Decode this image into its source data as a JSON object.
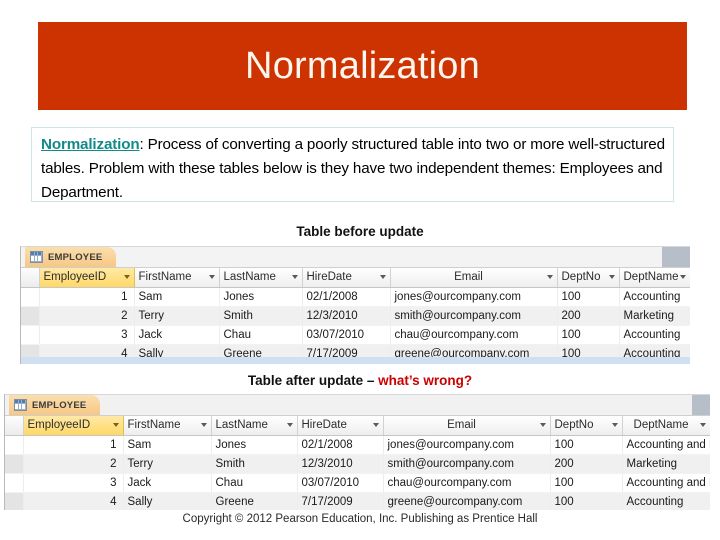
{
  "slide": {
    "title": "Normalization",
    "banner_color": "#cc3300"
  },
  "definition": {
    "term": "Normalization",
    "term_color": "#128a8a",
    "body": ": Process of converting a poorly structured table into two or more well-structured tables. Problem with these tables below is they have two independent themes: Employees and Department."
  },
  "captions": {
    "before": "Table before update",
    "after_prefix": "Table after update – ",
    "after_highlight": "what’s wrong?",
    "highlight_color": "#cc0000"
  },
  "table_before": {
    "tab_label": "EMPLOYEE",
    "tab_icon": "grid-icon",
    "columns": [
      "EmployeeID",
      "FirstName",
      "LastName",
      "HireDate",
      "Email",
      "DeptNo",
      "DeptName"
    ],
    "rows": [
      [
        "1",
        "Sam",
        "Jones",
        "02/1/2008",
        "jones@ourcompany.com",
        "100",
        "Accounting"
      ],
      [
        "2",
        "Terry",
        "Smith",
        "12/3/2010",
        "smith@ourcompany.com",
        "200",
        "Marketing"
      ],
      [
        "3",
        "Jack",
        "Chau",
        "03/07/2010",
        "chau@ourcompany.com",
        "100",
        "Accounting"
      ],
      [
        "4",
        "Sally",
        "Greene",
        "7/17/2009",
        "greene@ourcompany.com",
        "100",
        "Accounting"
      ]
    ]
  },
  "table_after": {
    "tab_label": "EMPLOYEE",
    "tab_icon": "grid-icon",
    "columns": [
      "EmployeeID",
      "FirstName",
      "LastName",
      "HireDate",
      "Email",
      "DeptNo",
      "DeptName"
    ],
    "rows": [
      [
        "1",
        "Sam",
        "Jones",
        "02/1/2008",
        "jones@ourcompany.com",
        "100",
        "Accounting and Finance"
      ],
      [
        "2",
        "Terry",
        "Smith",
        "12/3/2010",
        "smith@ourcompany.com",
        "200",
        "Marketing"
      ],
      [
        "3",
        "Jack",
        "Chau",
        "03/07/2010",
        "chau@ourcompany.com",
        "100",
        "Accounting and Finance"
      ],
      [
        "4",
        "Sally",
        "Greene",
        "7/17/2009",
        "greene@ourcompany.com",
        "100",
        "Accounting"
      ]
    ]
  },
  "footer": {
    "text": "Copyright © 2012 Pearson Education, Inc. Publishing as Prentice Hall"
  }
}
